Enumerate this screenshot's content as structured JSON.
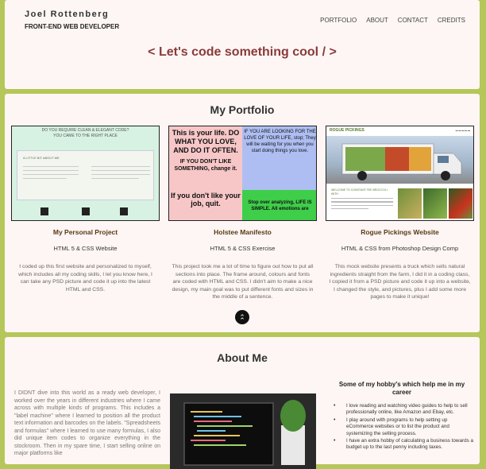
{
  "header": {
    "name": "Joel Rottenberg",
    "role": "FRONT-END WEB DEVELOPER",
    "nav": [
      "PORTFOLIO",
      "ABOUT",
      "CONTACT",
      "CREDITS"
    ],
    "tagline": "< Let's code something cool / >"
  },
  "portfolio": {
    "title": "My Portfolio",
    "projects": [
      {
        "title": "My Personal Project",
        "subtitle": "HTML 5 & CSS Website",
        "description": "I coded up this first website and personalized to myself, which includes all my coding skills, I let you know here, I can take any PSD picture and code it up into the latest HTML and CSS.",
        "thumb": {
          "heading_1": "DO YOU REQUIRE CLEAN & ELEGANT CODE?",
          "heading_2": "YOU CAME TO THE RIGHT PLACE",
          "label": "A LITTLE BIT ABOUT ME"
        }
      },
      {
        "title": "Holstee Manifesto",
        "subtitle": "HTML 5 & CSS Exercise",
        "description": "This project took me a lot of time to figure out how to put all sections into place. The frame around, colours and fonts are coded with HTML and CSS. I didn't aim to make a nice design, my main goal was to put different fonts and sizes in the middle of a sentence.",
        "thumb": {
          "q1": "This is your life. DO WHAT YOU LOVE, AND DO IT OFTEN.",
          "q1b": "IF YOU DON'T LIKE SOMETHING, change it.",
          "q2": "IF YOU ARE LOOKING FOR THE LOVE OF YOUR LIFE, stop; They will be waiting for you when you start doing things you love.",
          "q3": "If you don't like your job, quit.",
          "q4": "Stop over analyzing, LIFE IS SIMPLE. All emotions are"
        }
      },
      {
        "title": "Rogue Pickings Website",
        "subtitle": "HTML & CSS from Photoshop Design Comp",
        "description": "This mock website presents a truck which sells natural ingredients straight from the farm, I did it in a coding class, I copied it from a PSD picture and code it up into a website, I changed the style, and pictures, plus I add some more pages to make it unique!",
        "thumb": {
          "logo": "ROGUE PICKINGS",
          "caption": "WELCOME TO CONSTANT FEE BROCCOLI WITH"
        }
      }
    ],
    "back_to_top_icon": "double-chevron-up-icon"
  },
  "about": {
    "title": "About Me",
    "text": "I DIDNT dive into this world as a ready web developer, I worked over the years in different industries where I came across with multiple kinds of programs. This includes a \"label machine\" where I learned to position all the product text information and barcodes on the labels. \"Spreadsheets and formulas\" where I learned to use many formulas, I also did unique item codes to organize everything in the stockroom. Then in my spare time, I start selling online on major platforms like",
    "hobbies_title": "Some of my hobby's which help me in my career",
    "hobbies": [
      "I love reading and watching video guides to help to sell professionally online, like Amazon and Ebay, etc.",
      "I play around with programs to help setting up eCommerce websites or to list the product and systemizing the selling process.",
      "I have an extra hobby of calculating a business towards a budget up to the last penny including taxes."
    ]
  }
}
